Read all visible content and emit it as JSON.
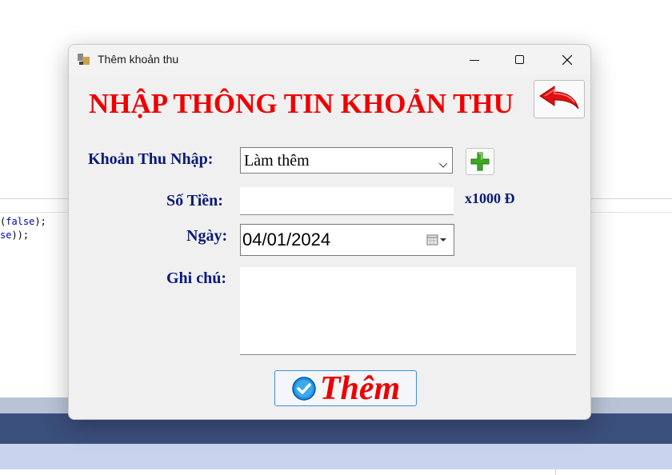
{
  "background": {
    "code_lines": [
      {
        "prefix": "(",
        "kw": "false",
        "suffix": ");"
      },
      {
        "prefix": "",
        "kw": "se",
        "suffix": "));"
      }
    ]
  },
  "window": {
    "title": "Thêm khoản thu",
    "controls": [
      "minimize-icon",
      "maximize-icon",
      "close-icon"
    ]
  },
  "form": {
    "heading": "NHẬP THÔNG TIN KHOẢN THU",
    "category_label": "Khoản Thu Nhập:",
    "category_value": "Làm thêm",
    "amount_label": "Số Tiền:",
    "amount_value": "",
    "amount_unit": "x1000 Đ",
    "date_label": "Ngày:",
    "date_value": "04/01/2024",
    "note_label": "Ghi chú:",
    "note_value": "",
    "submit_label": "Thêm"
  },
  "colors": {
    "heading": "#ee0000",
    "label": "#0a1a78",
    "submit_text": "#ee0000",
    "add_icon": "#3aa820"
  }
}
